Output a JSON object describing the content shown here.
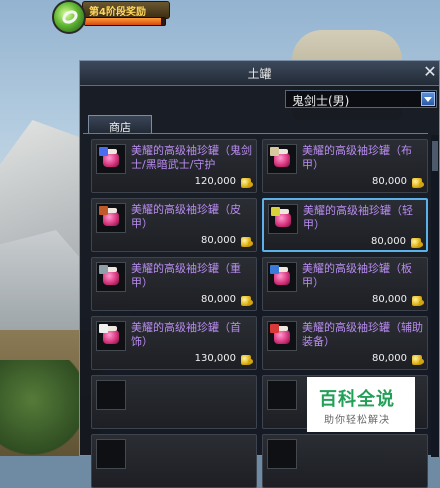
{
  "hud": {
    "stage_label": "第4阶段奖励",
    "progress": 0.95,
    "icon": "green-loop-orb-icon"
  },
  "window": {
    "title": "土罐",
    "close_icon": "close-x-icon",
    "class_select": {
      "value": "鬼剑士(男)",
      "icon": "chevron-down-icon"
    },
    "tab_label": "商店"
  },
  "items": [
    {
      "name": "美耀的高级袖珍罐（鬼剑士/黑暗武士/守护",
      "price": "120,000",
      "tag_color": "#4a6cf0",
      "selected": false
    },
    {
      "name": "美耀的高级袖珍罐（布甲）",
      "price": "80,000",
      "tag_color": "#d8c8a0",
      "selected": false
    },
    {
      "name": "美耀的高级袖珍罐（皮甲）",
      "price": "80,000",
      "tag_color": "#c05a2a",
      "selected": false
    },
    {
      "name": "美耀的高级袖珍罐（轻甲）",
      "price": "80,000",
      "tag_color": "#d9d33a",
      "selected": true
    },
    {
      "name": "美耀的高级袖珍罐（重甲）",
      "price": "80,000",
      "tag_color": "#8fa0a8",
      "selected": false
    },
    {
      "name": "美耀的高级袖珍罐（板甲）",
      "price": "80,000",
      "tag_color": "#3a7ad8",
      "selected": false
    },
    {
      "name": "美耀的高级袖珍罐（首饰）",
      "price": "130,000",
      "tag_color": "#f0f0f0",
      "selected": false
    },
    {
      "name": "美耀的高级袖珍罐（辅助装备）",
      "price": "80,000",
      "tag_color": "#d83a3a",
      "selected": false
    }
  ],
  "watermark": {
    "main": "百科全说",
    "sub": "助你轻松解决"
  },
  "colors": {
    "item_name": "#b98cf0",
    "selection": "#5bb2e8",
    "progress_fill": "#d44a0e"
  }
}
